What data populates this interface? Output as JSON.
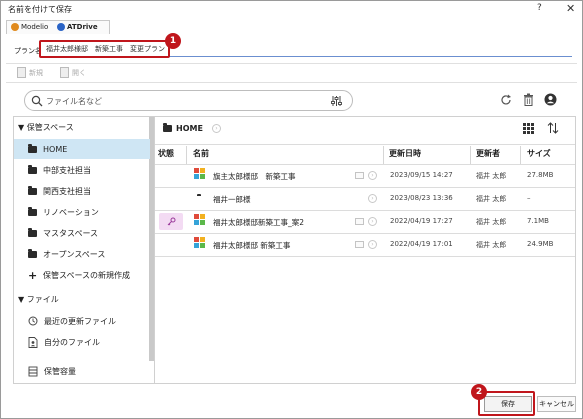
{
  "window": {
    "title": "名前を付けて保存",
    "help_glyph": "?",
    "close_glyph": "✕"
  },
  "app_tabs": [
    {
      "label": "Modelio",
      "color": "#e08a1e"
    },
    {
      "label": "ATDrive",
      "color": "#2a63c6"
    }
  ],
  "plan_name": {
    "label": "プラン名",
    "value": "福井太郎様邸　新築工事　変更プラン"
  },
  "toolbar": {
    "new_label": "新規",
    "open_label": "開く"
  },
  "search": {
    "placeholder": "ファイル名など",
    "icon": "search-icon"
  },
  "actions": {
    "refresh_icon": "refresh-icon",
    "trash_icon": "trash-icon",
    "account_icon": "account-icon"
  },
  "sidebar": {
    "storage_section": "保管スペース",
    "items": [
      {
        "label": "HOME",
        "selected": true
      },
      {
        "label": "中部支社担当"
      },
      {
        "label": "関西支社担当"
      },
      {
        "label": "リノベーション"
      },
      {
        "label": "マスタスペース"
      },
      {
        "label": "オープンスペース"
      }
    ],
    "create_storage": "保管スペースの新規作成",
    "file_section": "ファイル",
    "recent_files": "最近の更新ファイル",
    "my_files": "自分のファイル",
    "storage_capacity": "保管容量"
  },
  "breadcrumb": {
    "current": "HOME"
  },
  "table": {
    "headers": {
      "status": "状態",
      "name": "名前",
      "updated": "更新日時",
      "updater": "更新者",
      "size": "サイズ"
    },
    "rows": [
      {
        "type": "plan",
        "status": "",
        "name": "旗主太郎様邸　新築工事",
        "updated": "2023/09/15 14:27",
        "updater": "福井 太郎",
        "size": "27.8MB"
      },
      {
        "type": "folder",
        "status": "",
        "name": "福井一郎様",
        "updated": "2023/08/23 13:36",
        "updater": "福井 太郎",
        "size": "–"
      },
      {
        "type": "plan",
        "status": "locked",
        "name": "福井太郎様邸新築工事_案2",
        "updated": "2022/04/19 17:27",
        "updater": "福井 太郎",
        "size": "7.1MB"
      },
      {
        "type": "plan",
        "status": "",
        "name": "福井太郎様邸 新築工事",
        "updated": "2022/04/19 17:01",
        "updater": "福井 太郎",
        "size": "24.9MB"
      }
    ]
  },
  "callouts": {
    "one": "1",
    "two": "2"
  },
  "buttons": {
    "save": "保存",
    "cancel": "キャンセル"
  },
  "colors": {
    "accent": "#c0161c",
    "selection": "#cfe6f4",
    "input_underline": "#6b8fd0"
  }
}
